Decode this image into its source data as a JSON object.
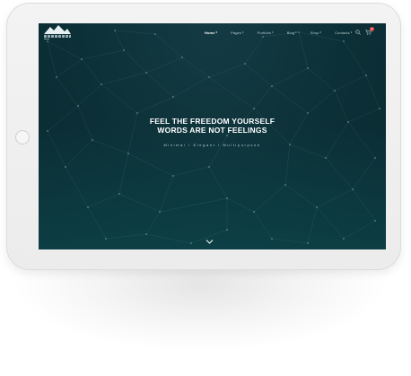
{
  "device": {
    "icons": [
      "home-button"
    ]
  },
  "navbar": {
    "items": [
      {
        "label": "Home",
        "active": true
      },
      {
        "label": "Pages",
        "active": false
      },
      {
        "label": "Portfolio",
        "active": false
      },
      {
        "label": "Blog",
        "active": false
      },
      {
        "label": "Shop",
        "active": false
      },
      {
        "label": "Contacts",
        "active": false
      }
    ],
    "caret": "▾",
    "cart_count": "0",
    "icons": [
      "logo-mountain",
      "search-icon",
      "cart-icon"
    ]
  },
  "hero": {
    "headline_line1": "FEEL THE FREEDOM YOURSELF",
    "headline_line2": "WORDS ARE NOT FEELINGS",
    "subtitle": "Minimal / Elegant / Multipurpose",
    "icons": [
      "chevron-down-icon"
    ]
  },
  "colors": {
    "screen_bg": "#0c3037",
    "screen_bottom": "#0e4e54",
    "text_white": "#ffffff",
    "nav_text": "#b9cfd3",
    "badge": "#e04646",
    "tablet_frame": "#eeeeee"
  }
}
